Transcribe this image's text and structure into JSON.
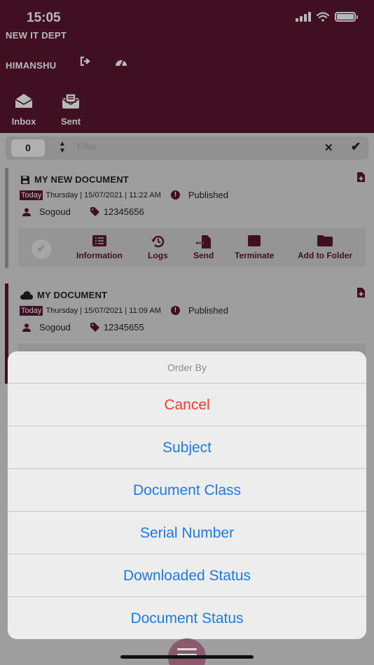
{
  "status_bar": {
    "time": "15:05"
  },
  "header": {
    "department": "NEW IT DEPT",
    "username": "HIMANSHU",
    "tabs": [
      {
        "label": "Inbox",
        "icon": "envelope-open-icon"
      },
      {
        "label": "Sent",
        "icon": "envelope-sent-icon"
      }
    ]
  },
  "filter_bar": {
    "count": "0",
    "placeholder": "Filter"
  },
  "documents": [
    {
      "title": "MY NEW DOCUMENT",
      "title_icon": "save-icon",
      "today": "Today",
      "datetime": "Thursday | 15/07/2021 | 11:22 AM",
      "status": "Published",
      "owner": "Sogoud",
      "serial": "12345656"
    },
    {
      "title": "MY DOCUMENT",
      "title_icon": "cloud-icon",
      "today": "Today",
      "datetime": "Thursday | 15/07/2021 | 11:09 AM",
      "status": "Published",
      "owner": "Sogoud",
      "serial": "12345655"
    }
  ],
  "actions": [
    "Information",
    "Logs",
    "Send",
    "Terminate",
    "Add to Folder"
  ],
  "order_sheet": {
    "title": "Order By",
    "cancel": "Cancel",
    "options": [
      "Subject",
      "Document Class",
      "Serial Number",
      "Downloaded Status",
      "Document Status"
    ]
  },
  "colors": {
    "brand": "#5b1530",
    "sheet_action": "#1f7ae0",
    "sheet_cancel": "#f03a2e"
  }
}
